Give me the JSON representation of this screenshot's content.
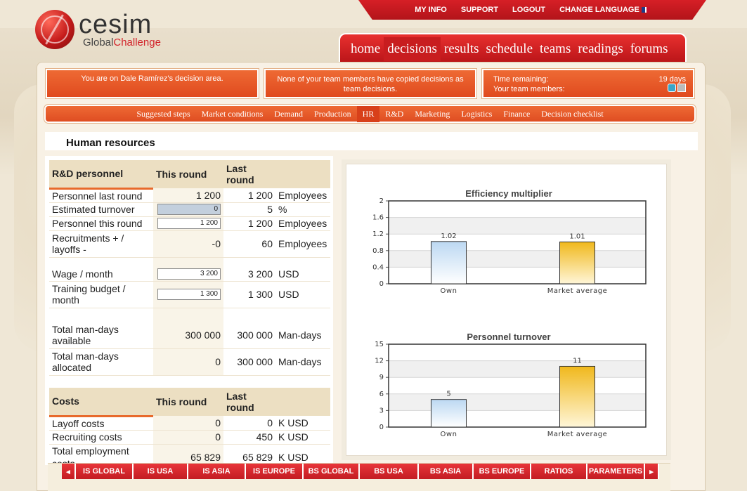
{
  "topnav": {
    "my_info": "MY INFO",
    "support": "SUPPORT",
    "logout": "LOGOUT",
    "change_language": "CHANGE LANGUAGE"
  },
  "logo": {
    "word": "cesim",
    "sub_a": "Global",
    "sub_b": "Challenge"
  },
  "mainnav": [
    "home",
    "decisions",
    "results",
    "schedule",
    "teams",
    "readings",
    "forums"
  ],
  "info": {
    "decision_area": "You are on Dale Ramírez's decision area.",
    "copied": "None of your team members have copied decisions as team decisions.",
    "time_label": "Time remaining:",
    "time_value": "19 days",
    "members_label": "Your team members:"
  },
  "subnav": [
    "Suggested steps",
    "Market conditions",
    "Demand",
    "Production",
    "HR",
    "R&D",
    "Marketing",
    "Logistics",
    "Finance",
    "Decision checklist"
  ],
  "section_title": "Human resources",
  "rd": {
    "header": {
      "label": "R&D personnel",
      "this_round": "This round",
      "last_round": "Last round"
    },
    "rows": {
      "personnel_last": {
        "label": "Personnel last round",
        "this": "1 200",
        "last": "1 200",
        "unit": "Employees"
      },
      "turnover": {
        "label": "Estimated turnover",
        "input": "0",
        "last": "5",
        "unit": "%"
      },
      "personnel_this": {
        "label": "Personnel this round",
        "input": "1 200",
        "last": "1 200",
        "unit": "Employees"
      },
      "recruit": {
        "label": "Recruitments + / layoffs -",
        "this": "-0",
        "last": "60",
        "unit": "Employees"
      },
      "wage": {
        "label": "Wage / month",
        "input": "3 200",
        "last": "3 200",
        "unit": "USD"
      },
      "training": {
        "label": "Training budget / month",
        "input": "1 300",
        "last": "1 300",
        "unit": "USD"
      },
      "mandays_avail": {
        "label": "Total man-days available",
        "this": "300 000",
        "last": "300 000",
        "unit": "Man-days"
      },
      "mandays_alloc": {
        "label": "Total man-days allocated",
        "this": "0",
        "last": "300 000",
        "unit": "Man-days"
      }
    }
  },
  "costs": {
    "header": {
      "label": "Costs",
      "this_round": "This round",
      "last_round": "Last round"
    },
    "rows": {
      "layoff": {
        "label": "Layoff costs",
        "this": "0",
        "last": "0",
        "unit": "K USD"
      },
      "recruiting": {
        "label": "Recruiting costs",
        "this": "0",
        "last": "450",
        "unit": "K USD"
      },
      "employment": {
        "label": "Total employment costs",
        "this": "65 829",
        "last": "65 829",
        "unit": "K USD"
      }
    }
  },
  "chart_data": [
    {
      "type": "bar",
      "title": "Efficiency multiplier",
      "categories": [
        "Own",
        "Market average"
      ],
      "values": [
        1.02,
        1.01
      ],
      "value_labels": [
        "1.02",
        "1.01"
      ],
      "ylim": [
        0,
        2
      ],
      "yticks": [
        "0",
        "0.4",
        "0.8",
        "1.2",
        "1.6",
        "2"
      ],
      "colors": [
        "#bcd8f2",
        "#f4c430"
      ],
      "grid": true
    },
    {
      "type": "bar",
      "title": "Personnel turnover",
      "categories": [
        "Own",
        "Market average"
      ],
      "values": [
        5,
        11
      ],
      "value_labels": [
        "5",
        "11"
      ],
      "ylim": [
        0,
        15
      ],
      "yticks": [
        "0",
        "3",
        "6",
        "9",
        "12",
        "15"
      ],
      "colors": [
        "#bcd8f2",
        "#f4c430"
      ],
      "grid": true
    }
  ],
  "bottom_tabs": [
    "IS GLOBAL",
    "IS USA",
    "IS ASIA",
    "IS EUROPE",
    "BS GLOBAL",
    "BS USA",
    "BS ASIA",
    "BS EUROPE",
    "RATIOS",
    "PARAMETERS"
  ]
}
